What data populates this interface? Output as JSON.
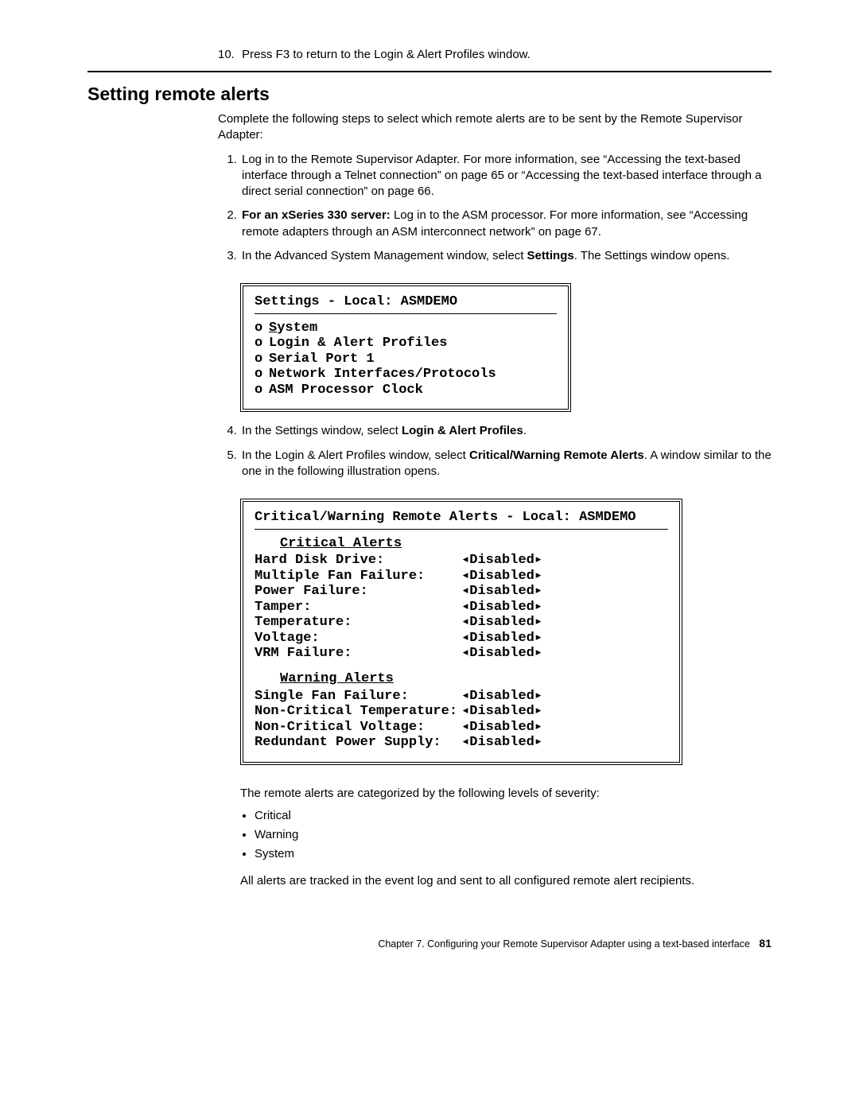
{
  "step10": {
    "num": "10.",
    "text": "Press F3 to return to the Login & Alert Profiles window."
  },
  "heading": "Setting remote alerts",
  "intro": "Complete the following steps to select which remote alerts are to be sent by the Remote Supervisor Adapter:",
  "steps": {
    "s1": "Log in to the Remote Supervisor Adapter. For more information, see “Accessing the text-based interface through a Telnet connection” on page 65 or “Accessing the text-based interface through a direct serial connection” on page 66.",
    "s2_bold": "For an xSeries 330 server:",
    "s2_rest": " Log in to the ASM processor. For more information, see “Accessing remote adapters through an ASM interconnect network” on page 67.",
    "s3_pre": "In the Advanced System Management window, select ",
    "s3_bold": "Settings",
    "s3_post": ". The Settings window opens.",
    "s4_pre": "In the Settings window, select ",
    "s4_bold": "Login & Alert Profiles",
    "s4_post": ".",
    "s5_pre": "In the Login & Alert Profiles window, select ",
    "s5_bold": "Critical/Warning Remote Alerts",
    "s5_post": ". A window similar to the one in the following illustration opens."
  },
  "screenshot1": {
    "title": "Settings - Local: ASMDEMO",
    "items": {
      "i0_head": "S",
      "i0_tail": "ystem",
      "i1": "Login & Alert Profiles",
      "i2": "Serial Port 1",
      "i3": "Network Interfaces/Protocols",
      "i4": "ASM Processor Clock"
    }
  },
  "screenshot2": {
    "title": "Critical/Warning Remote Alerts - Local: ASMDEMO",
    "sec1": "Critical Alerts",
    "crit": {
      "r0": {
        "label": "Hard Disk Drive:",
        "val": "Disabled"
      },
      "r1": {
        "label": "Multiple Fan Failure:",
        "val": "Disabled"
      },
      "r2": {
        "label": "Power Failure:",
        "val": "Disabled"
      },
      "r3": {
        "label": "Tamper:",
        "val": "Disabled"
      },
      "r4": {
        "label": "Temperature:",
        "val": "Disabled"
      },
      "r5": {
        "label": "Voltage:",
        "val": "Disabled"
      },
      "r6": {
        "label": "VRM Failure:",
        "val": "Disabled"
      }
    },
    "sec2": "Warning Alerts",
    "warn": {
      "r0": {
        "label": "Single Fan Failure:",
        "val": "Disabled"
      },
      "r1": {
        "label": "Non-Critical Temperature:",
        "val": "Disabled"
      },
      "r2": {
        "label": "Non-Critical Voltage:",
        "val": "Disabled"
      },
      "r3": {
        "label": "Redundant Power Supply:",
        "val": "Disabled"
      }
    }
  },
  "after": {
    "p1": "The remote alerts are categorized by the following levels of severity:",
    "b0": "Critical",
    "b1": "Warning",
    "b2": "System",
    "p2": "All alerts are tracked in the event log and sent to all configured remote alert recipients."
  },
  "footer": {
    "text": "Chapter 7. Configuring your Remote Supervisor Adapter using a text-based interface",
    "page": "81"
  }
}
